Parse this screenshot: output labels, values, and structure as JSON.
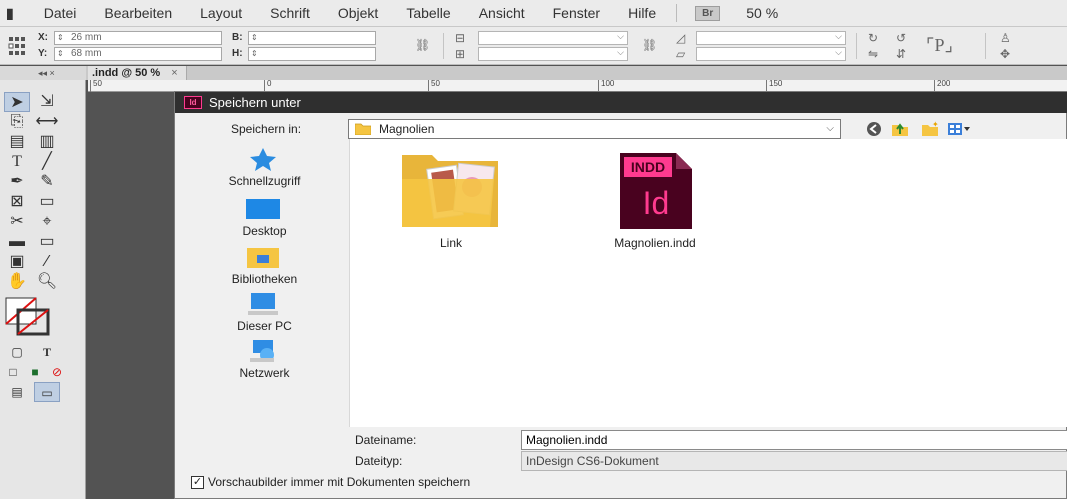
{
  "menu": {
    "items": [
      "Datei",
      "Bearbeiten",
      "Layout",
      "Schrift",
      "Objekt",
      "Tabelle",
      "Ansicht",
      "Fenster",
      "Hilfe"
    ],
    "bridge_badge": "Br",
    "zoom": "50 %"
  },
  "control": {
    "x_label": "X:",
    "x_value": "26 mm",
    "y_label": "Y:",
    "y_value": "68 mm",
    "w_label": "B:",
    "h_label": "H:"
  },
  "doc_tab": {
    "title": ".indd @ 50 %",
    "close": "×",
    "panel_controls": "◂◂  ×"
  },
  "ruler": {
    "ticks": [
      "50",
      "0",
      "50",
      "100",
      "150",
      "200"
    ]
  },
  "dialog": {
    "badge": "Id",
    "title": "Speichern unter",
    "save_in_label": "Speichern in:",
    "save_in_value": "Magnolien",
    "places": [
      "Schnellzugriff",
      "Desktop",
      "Bibliotheken",
      "Dieser PC",
      "Netzwerk"
    ],
    "files": [
      {
        "name": "Link",
        "type": "folder"
      },
      {
        "name": "Magnolien.indd",
        "type": "indd",
        "badge": "INDD",
        "logo": "Id"
      }
    ],
    "filename_label": "Dateiname:",
    "filename_value": "Magnolien.indd",
    "filetype_label": "Dateityp:",
    "filetype_value": "InDesign CS6-Dokument",
    "preview_checkbox": "Vorschaubilder immer mit Dokumenten speichern",
    "preview_checked": true
  },
  "colors": {
    "indesign_dark": "#49021f",
    "indesign_accent": "#ff3b8f",
    "folder_yellow": "#f5c542",
    "selection_blue": "#bfcfe3"
  }
}
